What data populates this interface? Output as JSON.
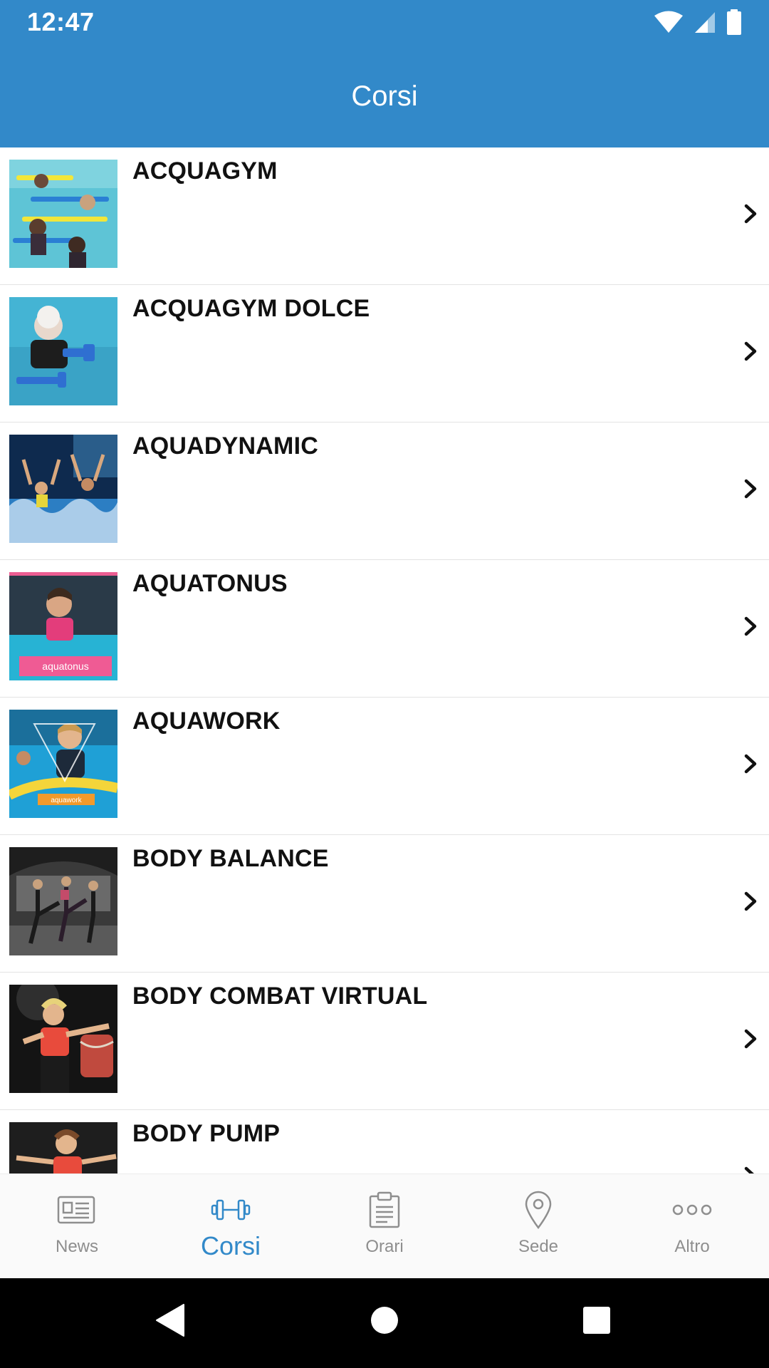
{
  "status_bar": {
    "time": "12:47"
  },
  "app_bar": {
    "title": "Corsi"
  },
  "courses": [
    {
      "name": "ACQUAGYM"
    },
    {
      "name": "ACQUAGYM DOLCE"
    },
    {
      "name": "AQUADYNAMIC"
    },
    {
      "name": "AQUATONUS",
      "thumb_text": "aquatonus"
    },
    {
      "name": "AQUAWORK",
      "thumb_text": "aquawork"
    },
    {
      "name": "BODY BALANCE"
    },
    {
      "name": "BODY COMBAT VIRTUAL"
    },
    {
      "name": "BODY PUMP"
    }
  ],
  "bottom_nav": {
    "items": [
      {
        "label": "News",
        "icon": "newspaper-icon"
      },
      {
        "label": "Corsi",
        "icon": "dumbbell-icon",
        "active": true
      },
      {
        "label": "Orari",
        "icon": "clipboard-icon"
      },
      {
        "label": "Sede",
        "icon": "location-pin-icon"
      },
      {
        "label": "Altro",
        "icon": "more-dots-icon"
      }
    ]
  },
  "colors": {
    "primary": "#3289C9",
    "inactive": "#8e8e8e",
    "text": "#111111"
  }
}
